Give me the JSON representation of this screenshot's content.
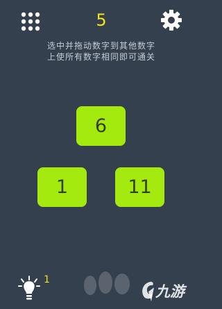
{
  "header": {
    "level": "5",
    "menu_icon": "grid-dots-icon",
    "settings_icon": "gear-icon"
  },
  "instructions": {
    "line1": "选中并拖动数字到其他数字",
    "line2": "上使所有数字相同即可通关"
  },
  "tiles": [
    {
      "value": "6"
    },
    {
      "value": "1"
    },
    {
      "value": "11"
    }
  ],
  "hint": {
    "icon": "lightbulb-icon",
    "count": "1"
  },
  "watermark": {
    "text": "九游"
  },
  "colors": {
    "background": "#35404e",
    "tile": "#a4ea0f",
    "accent_yellow": "#f2e318",
    "instruction_text": "#c6ccd4"
  }
}
